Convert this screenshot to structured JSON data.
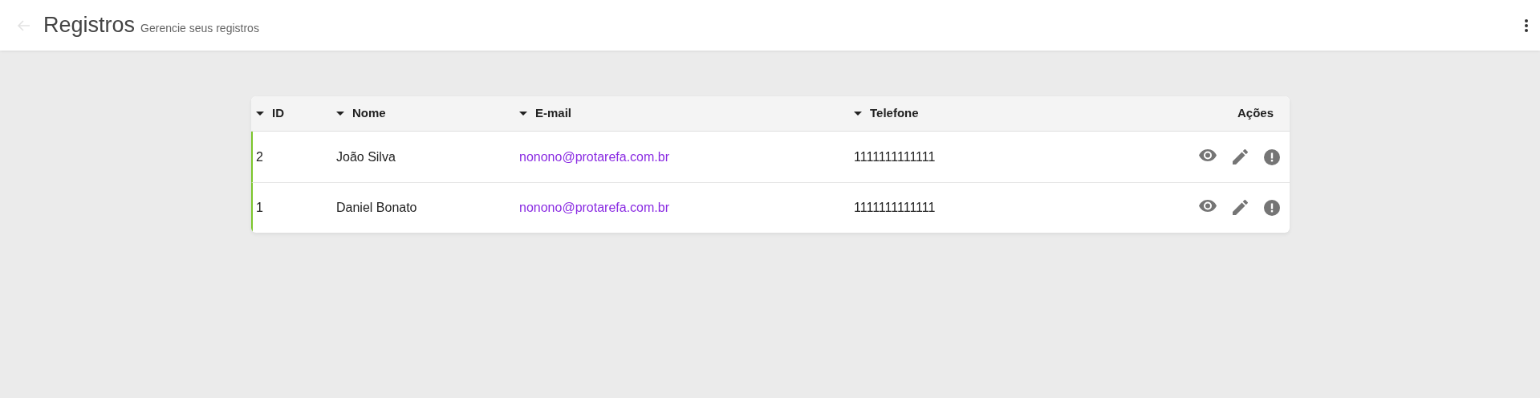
{
  "header": {
    "back_disabled": true,
    "title": "Registros",
    "subtitle": "Gerencie seus registros"
  },
  "table": {
    "columns": [
      {
        "label": "ID",
        "sortable": true
      },
      {
        "label": "Nome",
        "sortable": true
      },
      {
        "label": "E-mail",
        "sortable": true
      },
      {
        "label": "Telefone",
        "sortable": true
      },
      {
        "label": "Ações",
        "sortable": false
      }
    ],
    "rows": [
      {
        "id": "2",
        "name": "João Silva",
        "email": "nonono@protarefa.com.br",
        "phone": "1111111111111"
      },
      {
        "id": "1",
        "name": "Daniel Bonato",
        "email": "nonono@protarefa.com.br",
        "phone": "1111111111111"
      }
    ]
  }
}
